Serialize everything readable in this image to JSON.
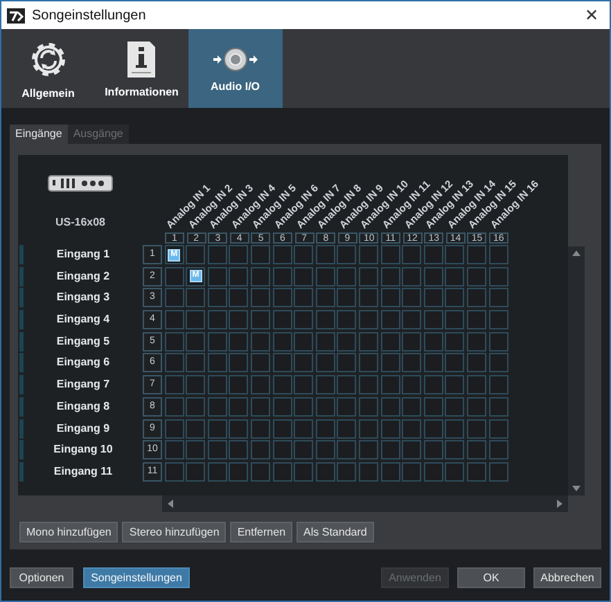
{
  "window": {
    "title": "Songeinstellungen",
    "close": "✕"
  },
  "tabs": [
    {
      "label": "Allgemein",
      "selected": false,
      "kind": "gear"
    },
    {
      "label": "Informationen",
      "selected": false,
      "kind": "info"
    },
    {
      "label": "Audio I/O",
      "selected": true,
      "kind": "audio"
    }
  ],
  "subtabs": [
    {
      "label": "Eingänge",
      "selected": true,
      "disabled": false
    },
    {
      "label": "Ausgänge",
      "selected": false,
      "disabled": true
    }
  ],
  "device": {
    "name": "US-16x08"
  },
  "columns": [
    {
      "label": "Analog IN 1",
      "number": "1"
    },
    {
      "label": "Analog IN 2",
      "number": "2"
    },
    {
      "label": "Analog IN 3",
      "number": "3"
    },
    {
      "label": "Analog IN 4",
      "number": "4"
    },
    {
      "label": "Analog IN 5",
      "number": "5"
    },
    {
      "label": "Analog IN 6",
      "number": "6"
    },
    {
      "label": "Analog IN 7",
      "number": "7"
    },
    {
      "label": "Analog IN 8",
      "number": "8"
    },
    {
      "label": "Analog IN 9",
      "number": "9"
    },
    {
      "label": "Analog IN 10",
      "number": "10"
    },
    {
      "label": "Analog IN 11",
      "number": "11"
    },
    {
      "label": "Analog IN 12",
      "number": "12"
    },
    {
      "label": "Analog IN 13",
      "number": "13"
    },
    {
      "label": "Analog IN 14",
      "number": "14"
    },
    {
      "label": "Analog IN 15",
      "number": "15"
    },
    {
      "label": "Analog IN 16",
      "number": "16"
    }
  ],
  "rows": [
    {
      "name": "Eingang 1",
      "number": "1",
      "cells": [
        {
          "selected": true,
          "label": "M"
        },
        {
          "selected": false
        },
        {
          "selected": false
        },
        {
          "selected": false
        },
        {
          "selected": false
        },
        {
          "selected": false
        },
        {
          "selected": false
        },
        {
          "selected": false
        },
        {
          "selected": false
        },
        {
          "selected": false
        },
        {
          "selected": false
        },
        {
          "selected": false
        },
        {
          "selected": false
        },
        {
          "selected": false
        },
        {
          "selected": false
        },
        {
          "selected": false
        }
      ]
    },
    {
      "name": "Eingang 2",
      "number": "2",
      "cells": [
        {
          "selected": false
        },
        {
          "selected": true,
          "label": "M"
        },
        {
          "selected": false
        },
        {
          "selected": false
        },
        {
          "selected": false
        },
        {
          "selected": false
        },
        {
          "selected": false
        },
        {
          "selected": false
        },
        {
          "selected": false
        },
        {
          "selected": false
        },
        {
          "selected": false
        },
        {
          "selected": false
        },
        {
          "selected": false
        },
        {
          "selected": false
        },
        {
          "selected": false
        },
        {
          "selected": false
        }
      ]
    },
    {
      "name": "Eingang 3",
      "number": "3",
      "cells": [
        {
          "selected": false
        },
        {
          "selected": false
        },
        {
          "selected": false
        },
        {
          "selected": false
        },
        {
          "selected": false
        },
        {
          "selected": false
        },
        {
          "selected": false
        },
        {
          "selected": false
        },
        {
          "selected": false
        },
        {
          "selected": false
        },
        {
          "selected": false
        },
        {
          "selected": false
        },
        {
          "selected": false
        },
        {
          "selected": false
        },
        {
          "selected": false
        },
        {
          "selected": false
        }
      ]
    },
    {
      "name": "Eingang 4",
      "number": "4",
      "cells": [
        {
          "selected": false
        },
        {
          "selected": false
        },
        {
          "selected": false
        },
        {
          "selected": false
        },
        {
          "selected": false
        },
        {
          "selected": false
        },
        {
          "selected": false
        },
        {
          "selected": false
        },
        {
          "selected": false
        },
        {
          "selected": false
        },
        {
          "selected": false
        },
        {
          "selected": false
        },
        {
          "selected": false
        },
        {
          "selected": false
        },
        {
          "selected": false
        },
        {
          "selected": false
        }
      ]
    },
    {
      "name": "Eingang 5",
      "number": "5",
      "cells": [
        {
          "selected": false
        },
        {
          "selected": false
        },
        {
          "selected": false
        },
        {
          "selected": false
        },
        {
          "selected": false
        },
        {
          "selected": false
        },
        {
          "selected": false
        },
        {
          "selected": false
        },
        {
          "selected": false
        },
        {
          "selected": false
        },
        {
          "selected": false
        },
        {
          "selected": false
        },
        {
          "selected": false
        },
        {
          "selected": false
        },
        {
          "selected": false
        },
        {
          "selected": false
        }
      ]
    },
    {
      "name": "Eingang 6",
      "number": "6",
      "cells": [
        {
          "selected": false
        },
        {
          "selected": false
        },
        {
          "selected": false
        },
        {
          "selected": false
        },
        {
          "selected": false
        },
        {
          "selected": false
        },
        {
          "selected": false
        },
        {
          "selected": false
        },
        {
          "selected": false
        },
        {
          "selected": false
        },
        {
          "selected": false
        },
        {
          "selected": false
        },
        {
          "selected": false
        },
        {
          "selected": false
        },
        {
          "selected": false
        },
        {
          "selected": false
        }
      ]
    },
    {
      "name": "Eingang 7",
      "number": "7",
      "cells": [
        {
          "selected": false
        },
        {
          "selected": false
        },
        {
          "selected": false
        },
        {
          "selected": false
        },
        {
          "selected": false
        },
        {
          "selected": false
        },
        {
          "selected": false
        },
        {
          "selected": false
        },
        {
          "selected": false
        },
        {
          "selected": false
        },
        {
          "selected": false
        },
        {
          "selected": false
        },
        {
          "selected": false
        },
        {
          "selected": false
        },
        {
          "selected": false
        },
        {
          "selected": false
        }
      ]
    },
    {
      "name": "Eingang 8",
      "number": "8",
      "cells": [
        {
          "selected": false
        },
        {
          "selected": false
        },
        {
          "selected": false
        },
        {
          "selected": false
        },
        {
          "selected": false
        },
        {
          "selected": false
        },
        {
          "selected": false
        },
        {
          "selected": false
        },
        {
          "selected": false
        },
        {
          "selected": false
        },
        {
          "selected": false
        },
        {
          "selected": false
        },
        {
          "selected": false
        },
        {
          "selected": false
        },
        {
          "selected": false
        },
        {
          "selected": false
        }
      ]
    },
    {
      "name": "Eingang 9",
      "number": "9",
      "cells": [
        {
          "selected": false
        },
        {
          "selected": false
        },
        {
          "selected": false
        },
        {
          "selected": false
        },
        {
          "selected": false
        },
        {
          "selected": false
        },
        {
          "selected": false
        },
        {
          "selected": false
        },
        {
          "selected": false
        },
        {
          "selected": false
        },
        {
          "selected": false
        },
        {
          "selected": false
        },
        {
          "selected": false
        },
        {
          "selected": false
        },
        {
          "selected": false
        },
        {
          "selected": false
        }
      ]
    },
    {
      "name": "Eingang 10",
      "number": "10",
      "cells": [
        {
          "selected": false
        },
        {
          "selected": false
        },
        {
          "selected": false
        },
        {
          "selected": false
        },
        {
          "selected": false
        },
        {
          "selected": false
        },
        {
          "selected": false
        },
        {
          "selected": false
        },
        {
          "selected": false
        },
        {
          "selected": false
        },
        {
          "selected": false
        },
        {
          "selected": false
        },
        {
          "selected": false
        },
        {
          "selected": false
        },
        {
          "selected": false
        },
        {
          "selected": false
        }
      ]
    },
    {
      "name": "Eingang 11",
      "number": "11",
      "cells": [
        {
          "selected": false
        },
        {
          "selected": false
        },
        {
          "selected": false
        },
        {
          "selected": false
        },
        {
          "selected": false
        },
        {
          "selected": false
        },
        {
          "selected": false
        },
        {
          "selected": false
        },
        {
          "selected": false
        },
        {
          "selected": false
        },
        {
          "selected": false
        },
        {
          "selected": false
        },
        {
          "selected": false
        },
        {
          "selected": false
        },
        {
          "selected": false
        },
        {
          "selected": false
        }
      ]
    }
  ],
  "actions": [
    "Mono hinzufügen",
    "Stereo hinzufügen",
    "Entfernen",
    "Als Standard"
  ],
  "footer_left": [
    {
      "label": "Optionen",
      "highlighted": false,
      "disabled": false
    },
    {
      "label": "Songeinstellungen",
      "highlighted": true,
      "disabled": false
    }
  ],
  "footer_right": [
    {
      "label": "Anwenden",
      "highlighted": false,
      "disabled": true
    },
    {
      "label": "OK",
      "highlighted": false,
      "disabled": false
    },
    {
      "label": "Abbrechen",
      "highlighted": false,
      "disabled": false
    }
  ]
}
